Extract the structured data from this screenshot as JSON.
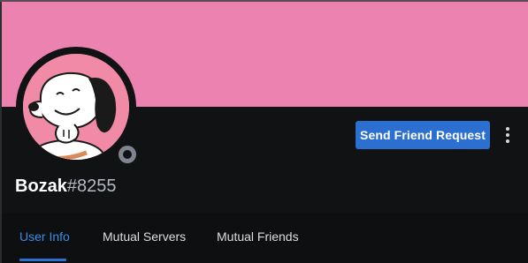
{
  "profile": {
    "username": "Bozak",
    "discriminator": "#8255",
    "status": "offline",
    "banner_color": "#ec82b0"
  },
  "actions": {
    "send_friend_request_label": "Send Friend Request",
    "more_icon": "more-vertical-icon"
  },
  "tabs": [
    {
      "label": "User Info",
      "active": true
    },
    {
      "label": "Mutual Servers",
      "active": false
    },
    {
      "label": "Mutual Friends",
      "active": false
    }
  ],
  "colors": {
    "accent": "#2b6fd1",
    "active_tab": "#3a8ee6",
    "background": "#111214"
  }
}
